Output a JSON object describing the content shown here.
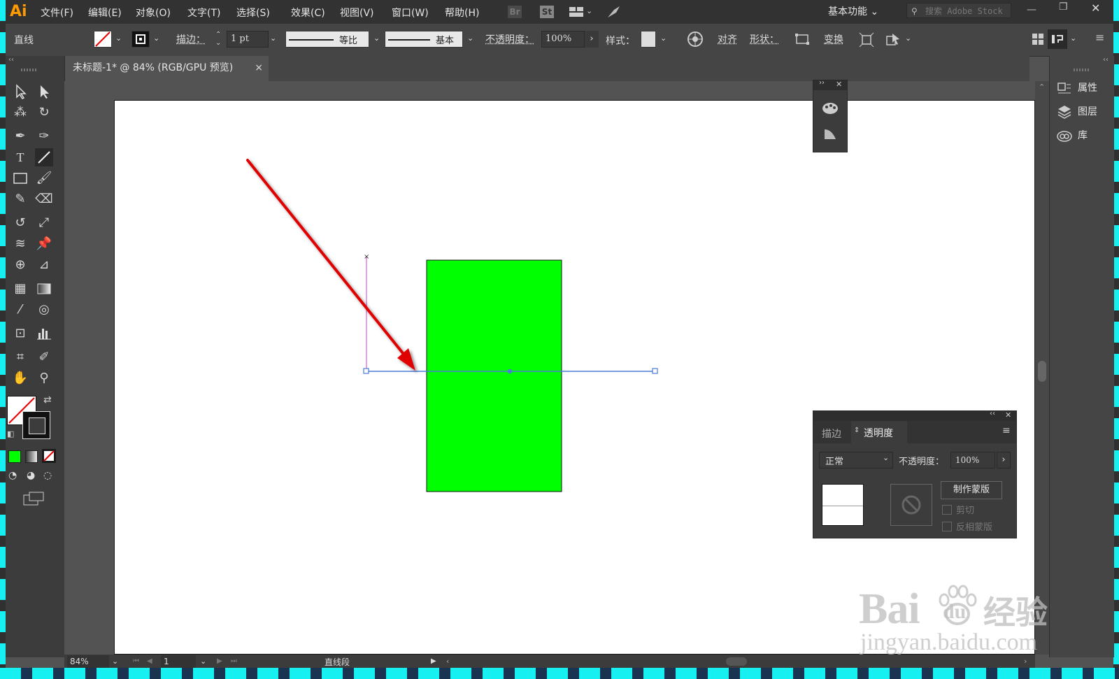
{
  "app": {
    "logo": "Ai"
  },
  "menubar": {
    "items": [
      "文件(F)",
      "编辑(E)",
      "对象(O)",
      "文字(T)",
      "选择(S)",
      "效果(C)",
      "视图(V)",
      "窗口(W)",
      "帮助(H)"
    ],
    "bridge": "Br",
    "stock": "St",
    "workspace": "基本功能",
    "search_placeholder": "搜索 Adobe Stock"
  },
  "controlbar": {
    "tool_name": "直线",
    "stroke_label": "描边：",
    "stroke_weight": "1 pt",
    "profile_label": "等比",
    "brush_label": "基本",
    "opacity_label": "不透明度：",
    "opacity_value": "100%",
    "style_label": "样式：",
    "align_label": "对齐",
    "shape_label": "形状：",
    "transform_label": "变换"
  },
  "document": {
    "tab_title": "未标题-1* @ 84% (RGB/GPU 预览)",
    "tab_close": "×"
  },
  "right_panel": {
    "items": [
      "属性",
      "图层",
      "库"
    ]
  },
  "transparency_panel": {
    "tab_stroke": "描边",
    "tab_transparency": "透明度",
    "blend_mode": "正常",
    "opacity_label": "不透明度：",
    "opacity_value": "100%",
    "make_mask": "制作蒙版",
    "clip_label": "剪切",
    "invert_label": "反相蒙版"
  },
  "statusbar": {
    "zoom": "84%",
    "page": "1",
    "status_text": "直线段"
  },
  "colors": {
    "rect_fill": "#00ff00",
    "arrow": "#e00000",
    "selection": "#4a7bd6",
    "guide": "#cc44cc"
  },
  "watermark": {
    "brand": "Bai",
    "brand_du": "du",
    "brand_cn": "经验",
    "url": "jingyan.baidu.com"
  }
}
